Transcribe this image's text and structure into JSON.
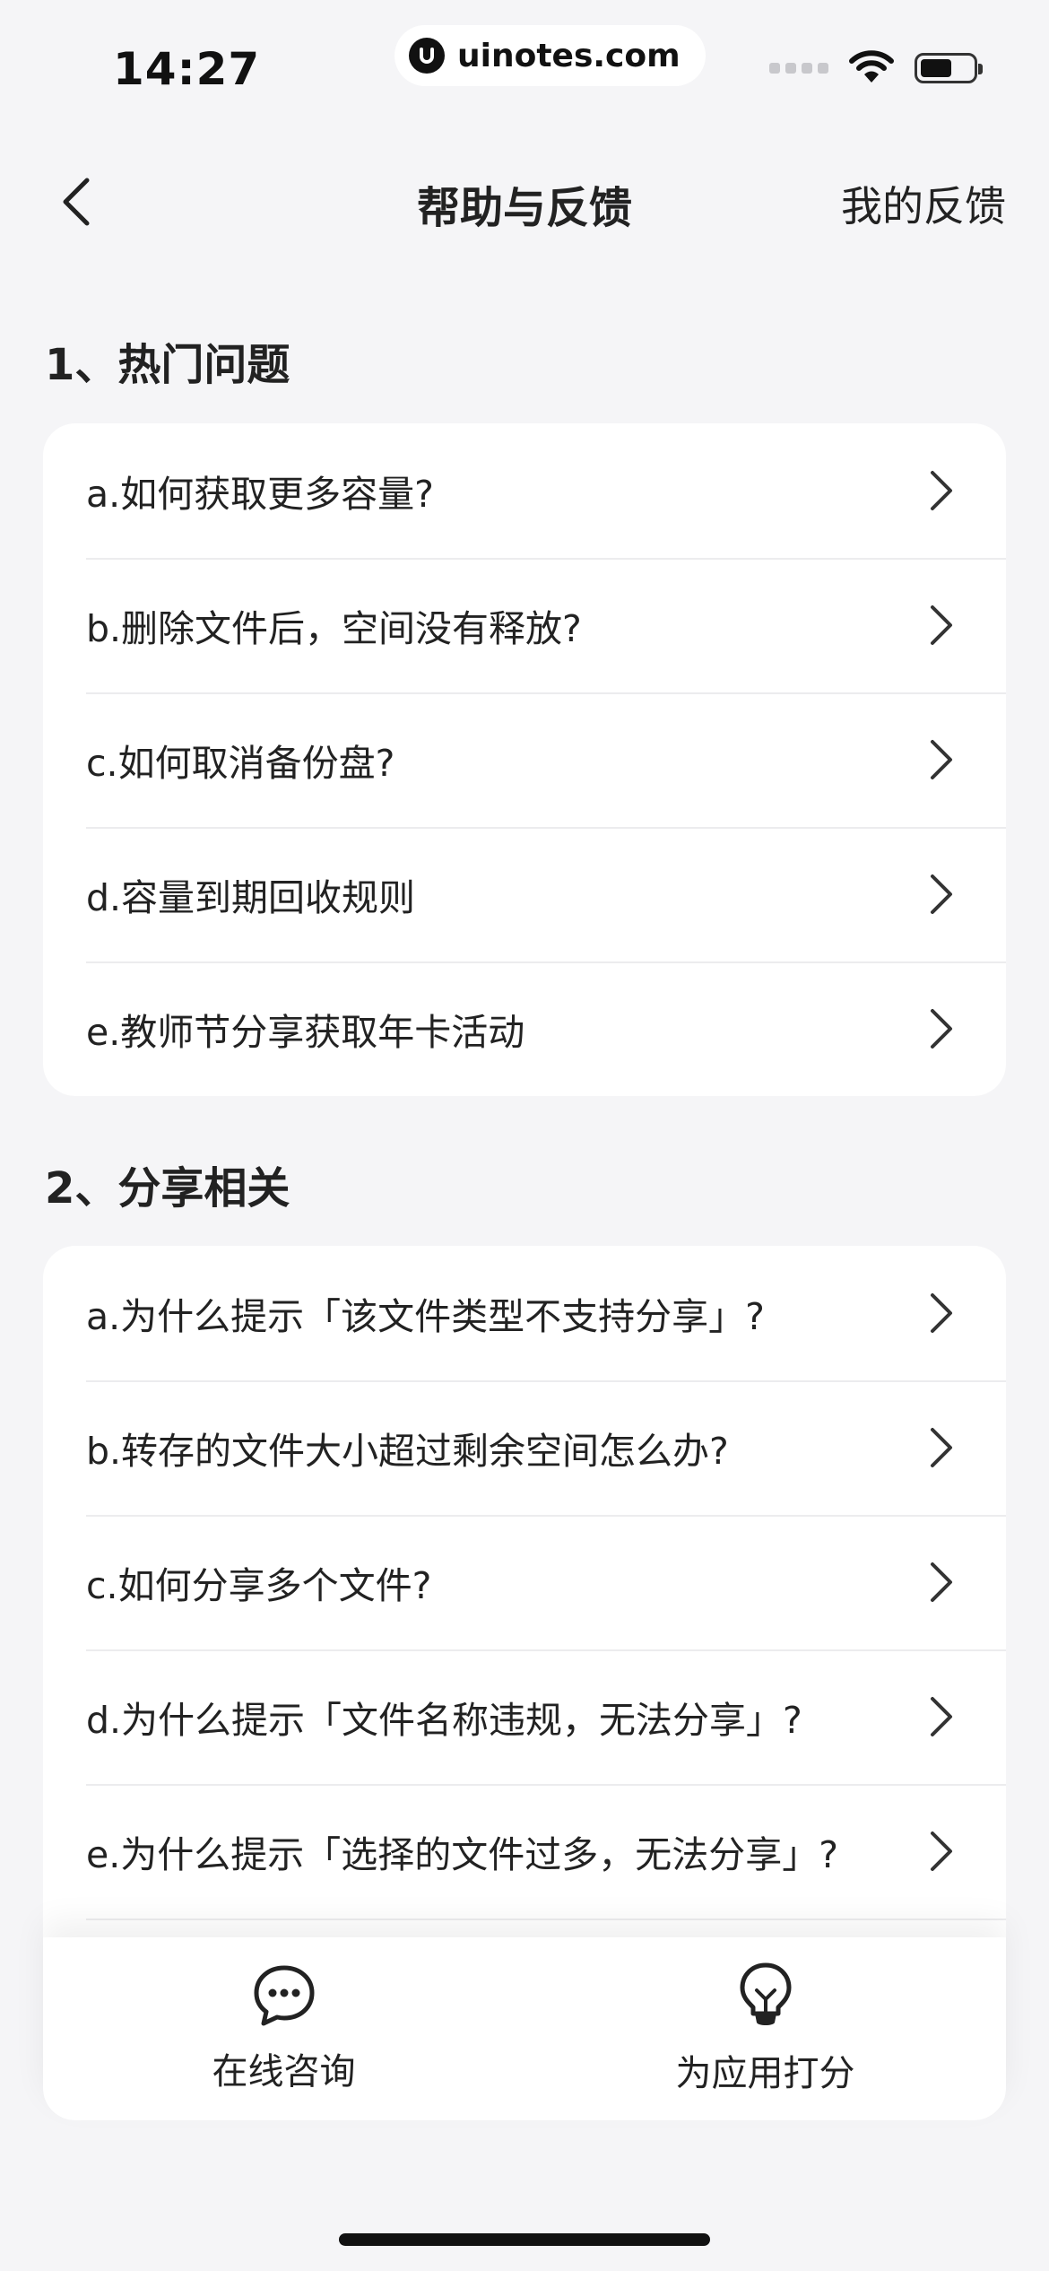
{
  "status_bar": {
    "time": "14:27",
    "watermark": "uinotes.com",
    "battery_level": 0.6
  },
  "nav": {
    "title": "帮助与反馈",
    "right_label": "我的反馈"
  },
  "sections": [
    {
      "title": "1、热门问题",
      "items": [
        {
          "label": "a.如何获取更多容量?"
        },
        {
          "label": "b.删除文件后，空间没有释放?"
        },
        {
          "label": "c.如何取消备份盘?"
        },
        {
          "label": "d.容量到期回收规则"
        },
        {
          "label": "e.教师节分享获取年卡活动"
        }
      ]
    },
    {
      "title": "2、分享相关",
      "items": [
        {
          "label": "a.为什么提示「该文件类型不支持分享」?"
        },
        {
          "label": "b.转存的文件大小超过剩余空间怎么办?"
        },
        {
          "label": "c.如何分享多个文件?"
        },
        {
          "label": "d.为什么提示「文件名称违规，无法分享」?"
        },
        {
          "label": "e.为什么提示「选择的文件过多，无法分享」?"
        }
      ]
    }
  ],
  "bottom_actions": [
    {
      "label": "在线咨询",
      "icon": "chat-bubble-icon"
    },
    {
      "label": "为应用打分",
      "icon": "lightbulb-icon"
    }
  ]
}
